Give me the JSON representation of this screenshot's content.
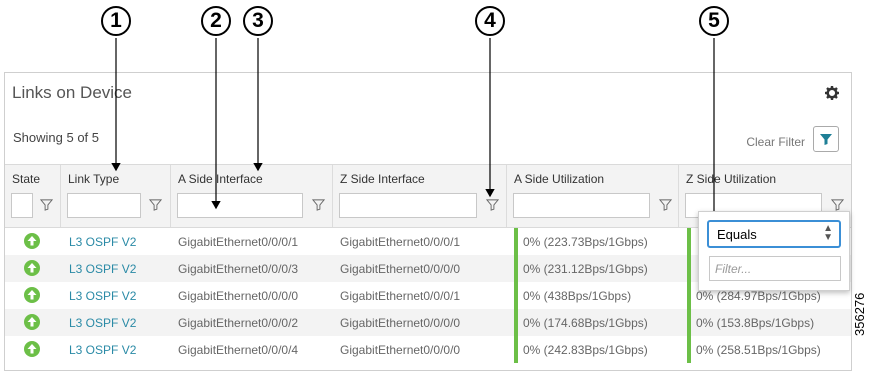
{
  "callouts": [
    "1",
    "2",
    "3",
    "4",
    "5"
  ],
  "panel": {
    "title": "Links on Device",
    "showing": "Showing 5 of 5",
    "clear_filter": "Clear Filter"
  },
  "columns": [
    {
      "label": "State"
    },
    {
      "label": "Link Type"
    },
    {
      "label": "A Side Interface"
    },
    {
      "label": "Z Side Interface"
    },
    {
      "label": "A Side Utilization"
    },
    {
      "label": "Z Side Utilization"
    }
  ],
  "rows": [
    {
      "link_type": "L3 OSPF V2",
      "a_side": "GigabitEthernet0/0/0/1",
      "z_side": "GigabitEthernet0/0/0/1",
      "a_util": "0% (223.73Bps/1Gbps)",
      "z_util": ""
    },
    {
      "link_type": "L3 OSPF V2",
      "a_side": "GigabitEthernet0/0/0/3",
      "z_side": "GigabitEthernet0/0/0/0",
      "a_util": "0% (231.12Bps/1Gbps)",
      "z_util": ""
    },
    {
      "link_type": "L3 OSPF V2",
      "a_side": "GigabitEthernet0/0/0/0",
      "z_side": "GigabitEthernet0/0/0/1",
      "a_util": "0% (438Bps/1Gbps)",
      "z_util": "0% (284.97Bps/1Gbps)"
    },
    {
      "link_type": "L3 OSPF V2",
      "a_side": "GigabitEthernet0/0/0/2",
      "z_side": "GigabitEthernet0/0/0/0",
      "a_util": "0% (174.68Bps/1Gbps)",
      "z_util": "0% (153.8Bps/1Gbps)"
    },
    {
      "link_type": "L3 OSPF V2",
      "a_side": "GigabitEthernet0/0/0/4",
      "z_side": "GigabitEthernet0/0/0/0",
      "a_util": "0% (242.83Bps/1Gbps)",
      "z_util": "0% (258.51Bps/1Gbps)"
    }
  ],
  "filter_popup": {
    "operator": "Equals",
    "placeholder": "Filter..."
  },
  "figure_id": "356276",
  "colors": {
    "status_up": "#6cbf47",
    "link": "#2a8aa6",
    "focus": "#3b8fd6"
  },
  "icons": [
    "gear-icon",
    "filter-icon",
    "arrow-up-icon"
  ]
}
